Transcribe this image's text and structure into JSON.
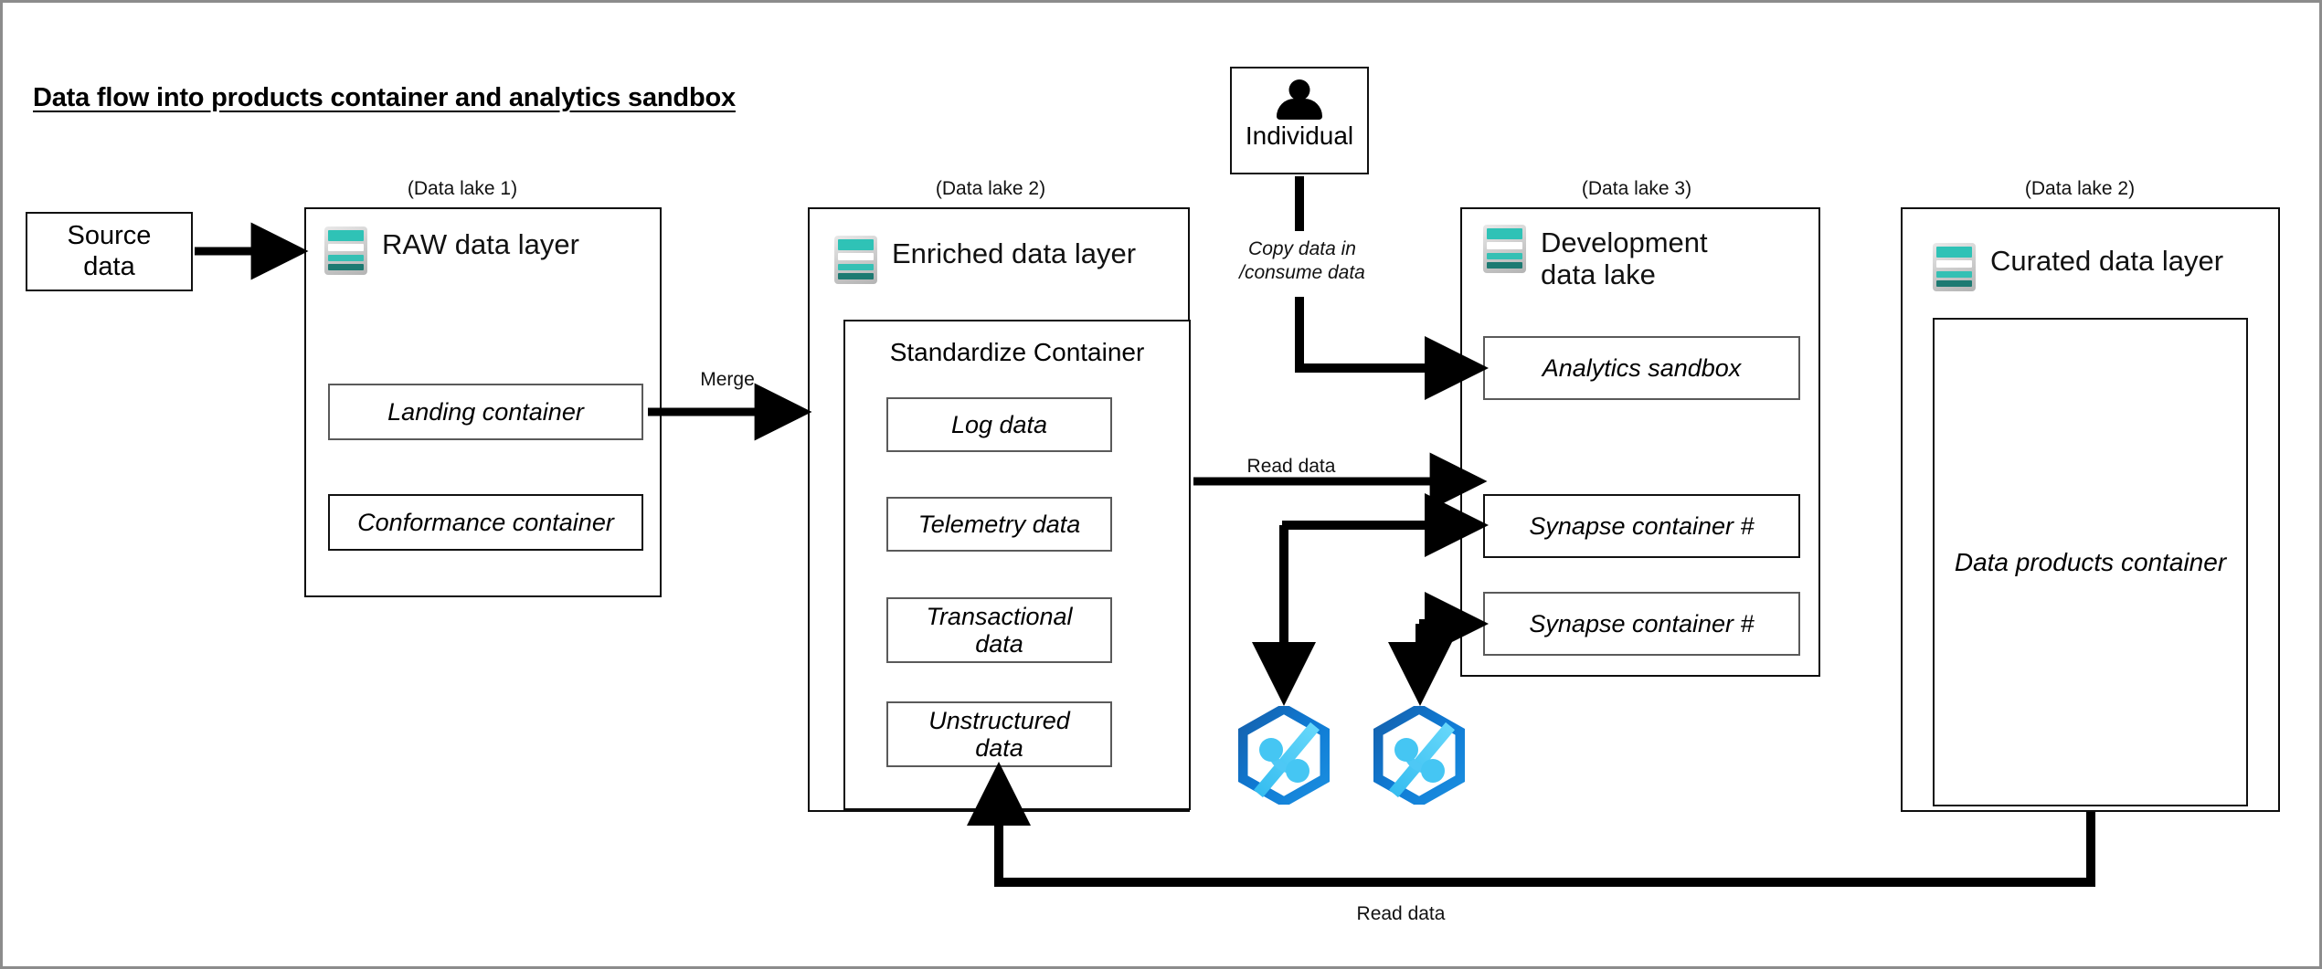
{
  "title": "Data flow into products container and analytics sandbox",
  "source": {
    "label": "Source\ndata"
  },
  "raw_zone": {
    "caption": "(Data lake 1)",
    "heading": "RAW data layer",
    "icon": "data-lake-icon",
    "containers": [
      {
        "label": "Landing container"
      },
      {
        "label": "Conformance container"
      }
    ]
  },
  "enriched_zone": {
    "caption": "(Data lake 2)",
    "heading": "Enriched data layer",
    "icon": "data-lake-icon",
    "standardize": {
      "label": "Standardize Container",
      "items": [
        {
          "label": "Log data"
        },
        {
          "label": "Telemetry data"
        },
        {
          "label": "Transactional\ndata"
        },
        {
          "label": "Unstructured\ndata"
        }
      ]
    }
  },
  "individual": {
    "label": "Individual",
    "icon": "person-icon"
  },
  "development_zone": {
    "caption": "(Data lake 3)",
    "heading": "Development\ndata lake",
    "icon": "data-lake-icon",
    "containers": [
      {
        "label": "Analytics sandbox"
      },
      {
        "label": "Synapse container #"
      },
      {
        "label": "Synapse container #"
      }
    ]
  },
  "curated_zone": {
    "caption": "(Data lake 2)",
    "heading": "Curated data layer",
    "icon": "data-lake-icon",
    "containers": [
      {
        "label": "Data products container"
      }
    ]
  },
  "synapse_logos": [
    {
      "name": "azure-synapse-logo"
    },
    {
      "name": "azure-synapse-logo"
    }
  ],
  "edges": [
    {
      "id": "merge",
      "label": "Merge"
    },
    {
      "id": "copy-consume",
      "label": "Copy data in\n/consume data"
    },
    {
      "id": "read-data-top",
      "label": "Read data"
    },
    {
      "id": "read-data-bottom",
      "label": "Read data"
    }
  ],
  "colors": {
    "accent_teal": "#2fc2b6",
    "accent_teal_dark": "#1d7a72",
    "synapse_blue": "#0f7ad4",
    "synapse_blue_dark": "#1560ab",
    "synapse_blue_light": "#4ec8f5",
    "line": "#000000",
    "frame": "#8c8c8c"
  }
}
